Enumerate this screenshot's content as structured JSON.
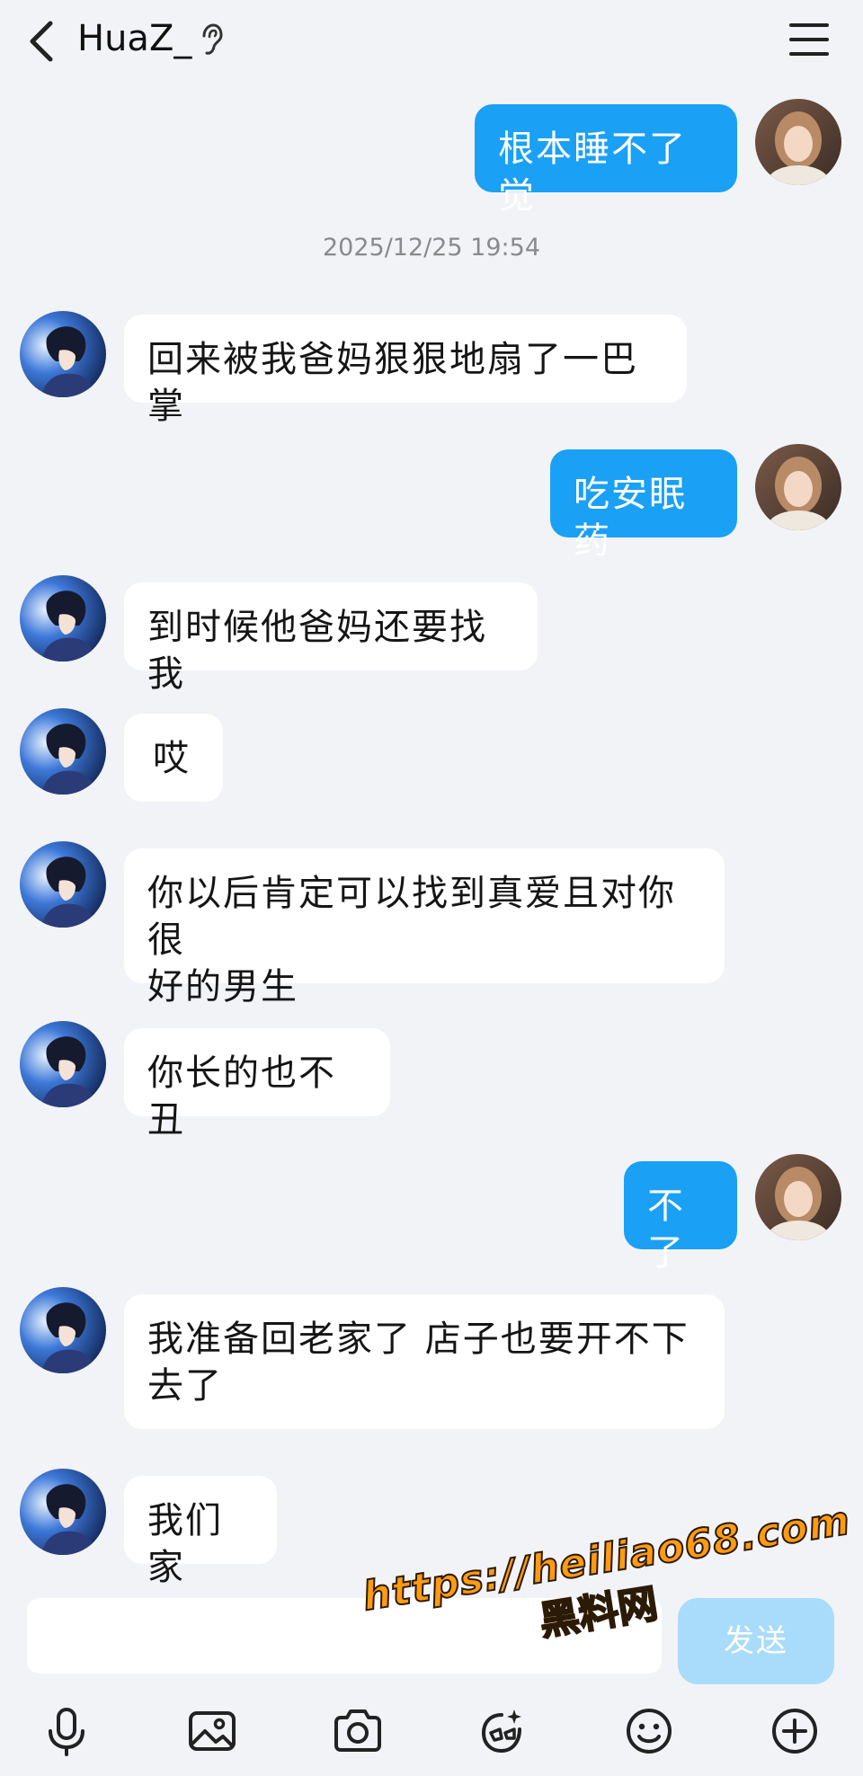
{
  "header": {
    "title": "HuaZ_"
  },
  "timestamp": "2025/12/25 19:54",
  "messages": [
    {
      "side": "out",
      "text": "根本睡不了觉"
    },
    {
      "side": "in",
      "text": "回来被我爸妈狠狠地扇了一巴掌"
    },
    {
      "side": "out",
      "text": "吃安眠药"
    },
    {
      "side": "in",
      "text": "到时候他爸妈还要找我"
    },
    {
      "side": "in",
      "text": "哎"
    },
    {
      "side": "in",
      "text": "你以后肯定可以找到真爱且对你很\n好的男生"
    },
    {
      "side": "in",
      "text": "你长的也不丑"
    },
    {
      "side": "out",
      "text": "不了"
    },
    {
      "side": "in",
      "text": "我准备回老家了 店子也要开不下\n去了"
    },
    {
      "side": "in",
      "text": "我们家"
    }
  ],
  "input": {
    "value": "",
    "send_label": "发送"
  },
  "watermark": {
    "url": "https://heiliao68.com",
    "text": "黑料网"
  },
  "toolbar": {
    "icons": [
      "microphone-icon",
      "image-icon",
      "camera-icon",
      "sticker-icon",
      "emoji-icon",
      "plus-icon"
    ]
  },
  "colors": {
    "outgoing_bubble": "#1aa0f5",
    "incoming_bubble": "#ffffff",
    "background": "#f2f3f7",
    "send_button": "#a9dcfb",
    "watermark": "#ff9b12"
  }
}
